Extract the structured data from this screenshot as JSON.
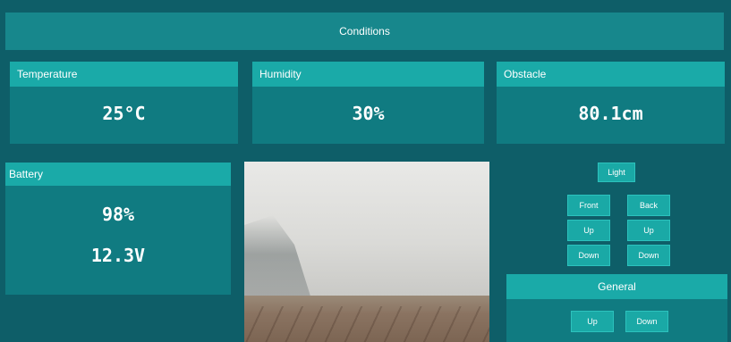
{
  "header": {
    "title": "Conditions"
  },
  "cards": {
    "temperature": {
      "label": "Temperature",
      "value": "25°C"
    },
    "humidity": {
      "label": "Humidity",
      "value": "30%"
    },
    "obstacle": {
      "label": "Obstacle",
      "value": "80.1cm"
    },
    "battery": {
      "label": "Battery",
      "percent": "98%",
      "voltage": "12.3V"
    }
  },
  "controls": {
    "light": "Light",
    "front": "Front",
    "back": "Back",
    "up_left": "Up",
    "up_right": "Up",
    "down_left": "Down",
    "down_right": "Down"
  },
  "general": {
    "title": "General",
    "up": "Up",
    "down": "Down"
  },
  "colors": {
    "background": "#0e5e68",
    "panel": "#107b81",
    "accent": "#1aaaa8"
  }
}
